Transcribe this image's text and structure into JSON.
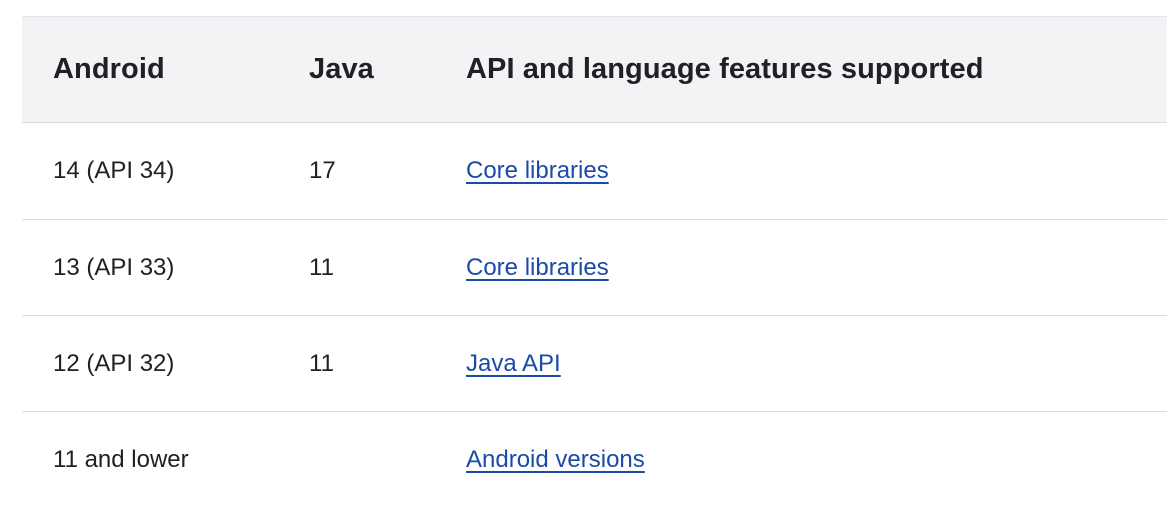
{
  "table": {
    "headers": [
      "Android",
      "Java",
      "API and language features supported"
    ],
    "rows": [
      {
        "android": "14 (API 34)",
        "java": "17",
        "link": "Core libraries"
      },
      {
        "android": "13 (API 33)",
        "java": "11",
        "link": "Core libraries"
      },
      {
        "android": "12 (API 32)",
        "java": "11",
        "link": "Java API"
      },
      {
        "android": "11 and lower",
        "java": "",
        "link": "Android versions"
      }
    ]
  },
  "colors": {
    "header_bg": "#f1f3f4",
    "link": "#1a4ba8",
    "text": "#202124",
    "divider": "#dadce0"
  }
}
